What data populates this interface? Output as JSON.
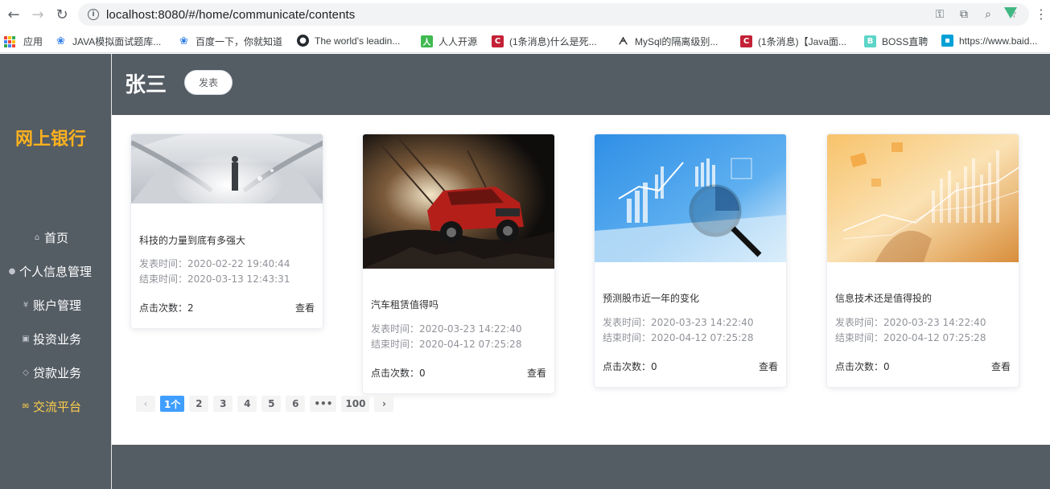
{
  "browser": {
    "url": "localhost:8080/#/home/communicate/contents",
    "bookmarks": [
      {
        "label": "应用",
        "icon": "apps-grid-icon"
      },
      {
        "label": "JAVA模拟面试题库...",
        "icon": "paw-icon"
      },
      {
        "label": "百度一下，你就知道",
        "icon": "paw-icon"
      },
      {
        "label": "The world's leadin...",
        "icon": "github-icon"
      },
      {
        "label": "人人开源",
        "icon": "renren-icon"
      },
      {
        "label": "(1条消息)什么是死...",
        "icon": "csdn-icon"
      },
      {
        "label": "MySql的隔离级别...",
        "icon": "scribble-icon"
      },
      {
        "label": "(1条消息)【Java面...",
        "icon": "csdn-icon"
      },
      {
        "label": "BOSS直聘",
        "icon": "boss-icon"
      },
      {
        "label": "https://www.baid...",
        "icon": "bilibili-icon"
      }
    ]
  },
  "sidebar": {
    "logo": "网上银行",
    "items": [
      {
        "label": "首页",
        "icon": "home-icon",
        "glyph": "⌂"
      },
      {
        "label": "个人信息管理",
        "icon": "user-icon",
        "glyph": "●"
      },
      {
        "label": "账户管理",
        "icon": "yen-icon",
        "glyph": "¥"
      },
      {
        "label": "投资业务",
        "icon": "money-icon",
        "glyph": "▣"
      },
      {
        "label": "贷款业务",
        "icon": "link-icon",
        "glyph": "◇"
      },
      {
        "label": "交流平台",
        "icon": "message-icon",
        "glyph": "✉",
        "active": true
      }
    ]
  },
  "header": {
    "user_name": "张三",
    "publish_label": "发表"
  },
  "cards": [
    {
      "title": "科技的力量到底有多强大",
      "publish_time": "发表时间：2020-02-22 19:40:44",
      "end_time": "结束时间：2020-03-13 12:43:31",
      "clicks": "点击次数：2",
      "view": "查看",
      "image": "futuristic-corridor"
    },
    {
      "title": "汽车租赁值得吗",
      "publish_time": "发表时间：2020-03-23 14:22:40",
      "end_time": "结束时间：2020-04-12 07:25:28",
      "clicks": "点击次数：0",
      "view": "查看",
      "image": "red-suv"
    },
    {
      "title": "预测股市近一年的变化",
      "publish_time": "发表时间：2020-03-23 14:22:40",
      "end_time": "结束时间：2020-04-12 07:25:28",
      "clicks": "点击次数：0",
      "view": "查看",
      "image": "blue-analytics"
    },
    {
      "title": "信息技术还是值得投的",
      "publish_time": "发表时间：2020-03-23 14:22:40",
      "end_time": "结束时间：2020-04-12 07:25:28",
      "clicks": "点击次数：0",
      "view": "查看",
      "image": "orange-finance"
    }
  ],
  "pagination": {
    "prev": "‹",
    "pages": [
      "1个",
      "2",
      "3",
      "4",
      "5",
      "6",
      "•••",
      "100"
    ],
    "next": "›",
    "current_index": 0
  },
  "colors": {
    "sidebar_bg": "#545c64",
    "logo": "#ffb21e",
    "active_menu": "#ffd04b",
    "pager_active": "#409eff"
  }
}
